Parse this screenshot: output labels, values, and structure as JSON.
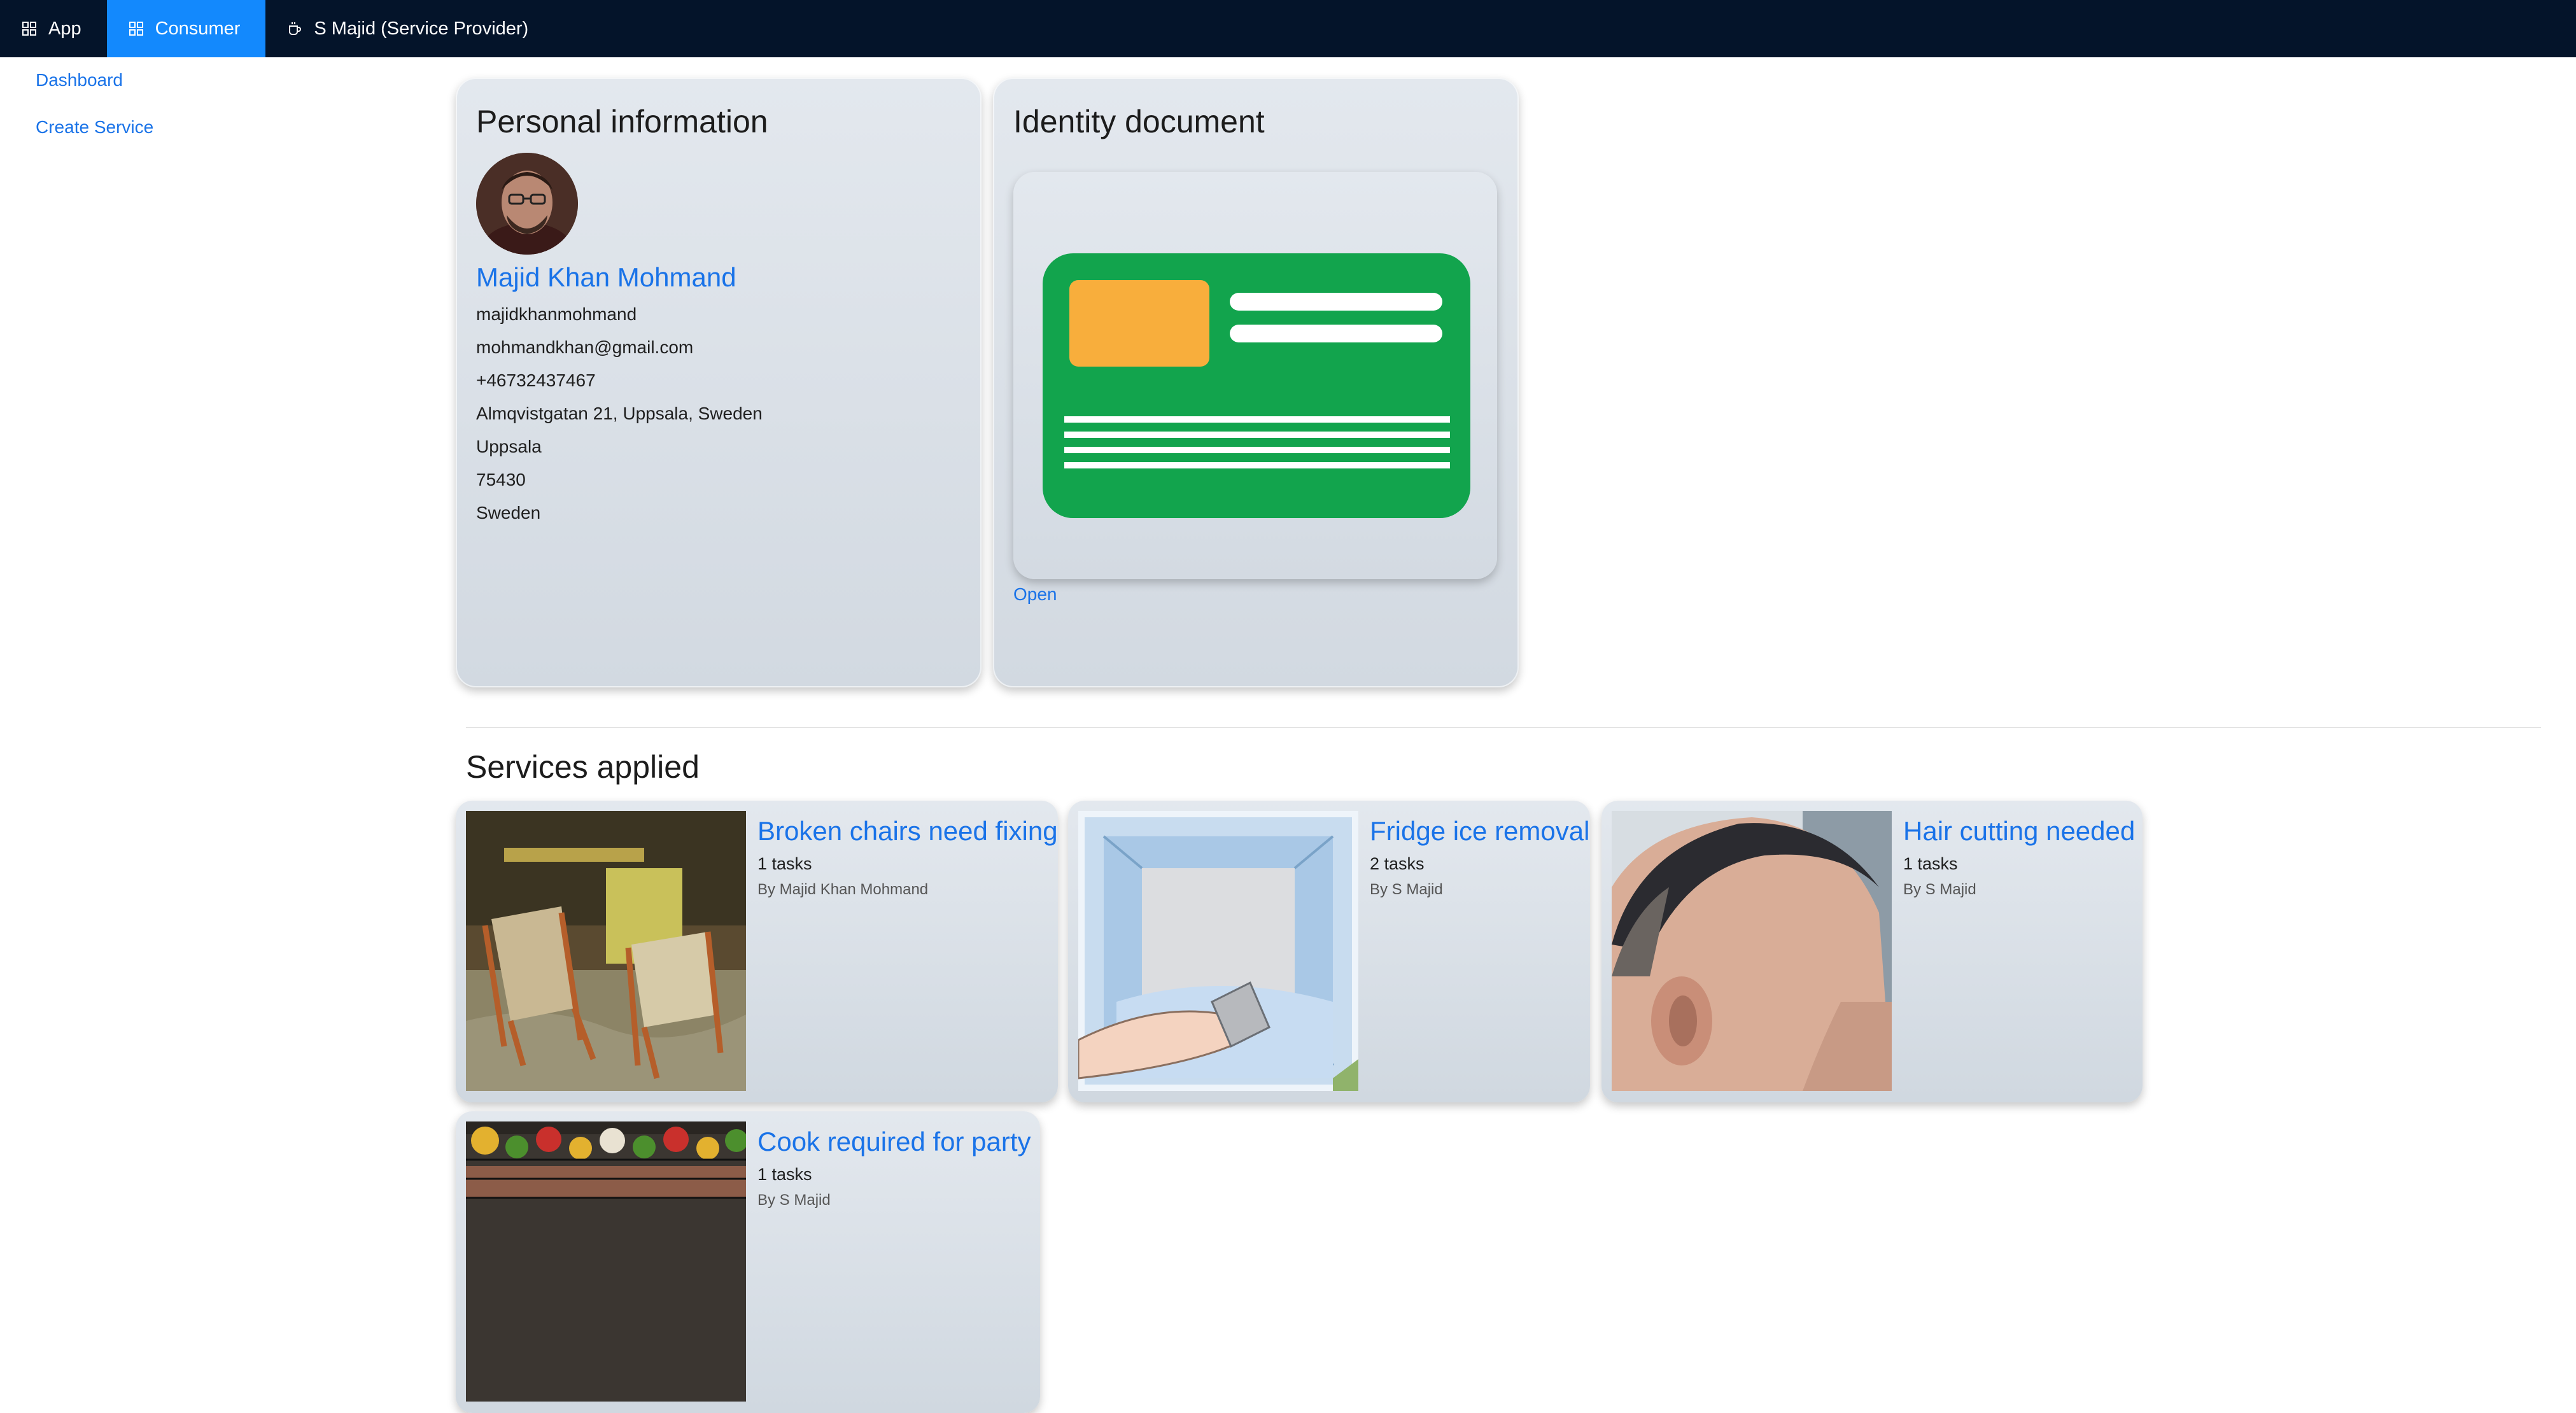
{
  "topbar": {
    "items": [
      {
        "label": "App",
        "icon": "grid-icon"
      },
      {
        "label": "Consumer",
        "icon": "grid-icon"
      },
      {
        "label": "S Majid (Service Provider)",
        "icon": "mug-icon"
      }
    ],
    "active_color": "#1389fd",
    "background": "#04142a"
  },
  "sidebar": {
    "items": [
      {
        "label": "Dashboard"
      },
      {
        "label": "Create Service"
      }
    ]
  },
  "personal": {
    "title": "Personal information",
    "name": "Majid Khan Mohmand",
    "username": "majidkhanmohmand",
    "email": "mohmandkhan@gmail.com",
    "phone": "+46732437467",
    "address": "Almqvistgatan 21, Uppsala, Sweden",
    "city": "Uppsala",
    "postal_code": "75430",
    "country": "Sweden"
  },
  "identity": {
    "title": "Identity document",
    "open_label": "Open"
  },
  "services": {
    "title": "Services applied",
    "items": [
      {
        "title": "Broken chairs need fixing",
        "tasks": "1 tasks",
        "by": "By Majid Khan Mohmand"
      },
      {
        "title": "Fridge ice removal",
        "tasks": "2 tasks",
        "by": "By S Majid"
      },
      {
        "title": "Hair cutting needed",
        "tasks": "1 tasks",
        "by": "By S Majid"
      },
      {
        "title": "Cook required for party",
        "tasks": "1 tasks",
        "by": "By S Majid"
      }
    ]
  }
}
